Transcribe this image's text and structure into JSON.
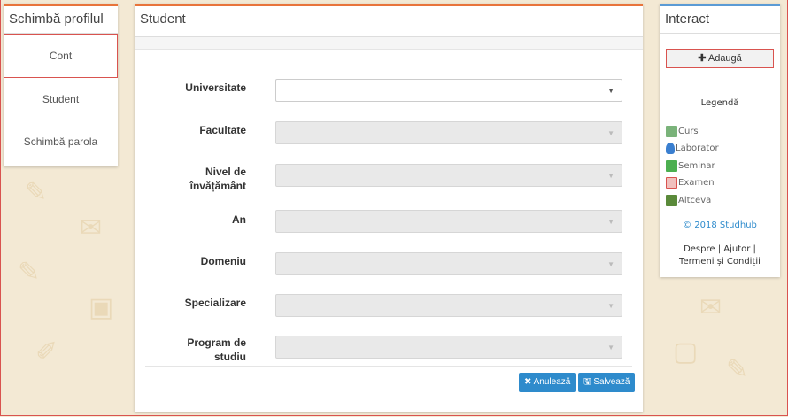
{
  "left_panel": {
    "title": "Schimbă profilul",
    "items": [
      {
        "label": "Cont"
      },
      {
        "label": "Student"
      },
      {
        "label": "Schimbă parola"
      }
    ]
  },
  "center_panel": {
    "title": "Student",
    "fields": [
      {
        "label": "Universitate",
        "value": ""
      },
      {
        "label": "Facultate",
        "value": ""
      },
      {
        "label": "Nivel de învățământ",
        "value": ""
      },
      {
        "label": "An",
        "value": ""
      },
      {
        "label": "Domeniu",
        "value": ""
      },
      {
        "label": "Specializare",
        "value": ""
      },
      {
        "label": "Program de studiu",
        "value": ""
      }
    ],
    "cancel_label": "Anulează",
    "save_label": "Salvează"
  },
  "right_panel": {
    "title": "Interact",
    "add_label": "Adaugă",
    "legend_title": "Legendă",
    "legend": [
      {
        "label": "Curs",
        "color": "#7ab37a"
      },
      {
        "label": "Laborator",
        "color": "#3a7fd0"
      },
      {
        "label": "Seminar",
        "color": "#4caf50"
      },
      {
        "label": "Examen",
        "color": "#d9534f"
      },
      {
        "label": "Altceva",
        "color": "#5a8a3a"
      }
    ],
    "copyright": "© 2018 Studhub",
    "links": {
      "despre": "Despre",
      "ajutor": "Ajutor",
      "termeni": "Termeni și Condiții"
    }
  }
}
